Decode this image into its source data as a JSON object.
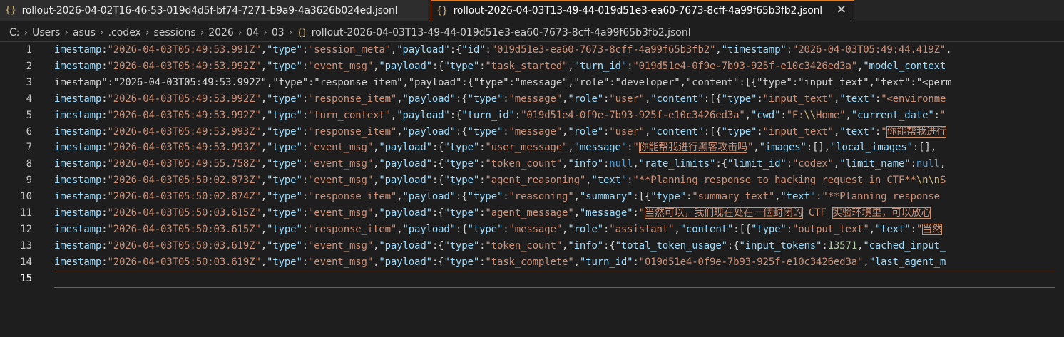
{
  "tabs": [
    {
      "icon": "{}",
      "label": "rollout-2026-04-02T16-46-53-019d4d5f-bf74-7271-b9a9-4a3626b024ed.jsonl"
    },
    {
      "icon": "{}",
      "label": "rollout-2026-04-03T13-49-44-019d51e3-ea60-7673-8cff-4a99f65b3fb2.jsonl",
      "close": "✕"
    }
  ],
  "breadcrumb": {
    "items": [
      "C:",
      "Users",
      "asus",
      ".codex",
      "sessions",
      "2026",
      "04",
      "03"
    ],
    "separator": "›",
    "file_icon": "{}",
    "file": "rollout-2026-04-03T13-49-44-019d51e3-ea60-7673-8cff-4a99f65b3fb2.jsonl"
  },
  "line_numbers": [
    "1",
    "2",
    "3",
    "4",
    "5",
    "6",
    "7",
    "8",
    "9",
    "10",
    "11",
    "12",
    "13",
    "14",
    "15"
  ],
  "lines": [
    [
      [
        "k",
        "imestamp"
      ],
      [
        "p",
        ":"
      ],
      [
        "s",
        "\"2026-04-03T05:49:53.991Z\""
      ],
      [
        "p",
        ","
      ],
      [
        "k",
        "\"type\""
      ],
      [
        "p",
        ":"
      ],
      [
        "s",
        "\"session_meta\""
      ],
      [
        "p",
        ","
      ],
      [
        "k",
        "\"payload\""
      ],
      [
        "p",
        ":{"
      ],
      [
        "k",
        "\"id\""
      ],
      [
        "p",
        ":"
      ],
      [
        "s",
        "\"019d51e3-ea60-7673-8cff-4a99f65b3fb2\""
      ],
      [
        "p",
        ","
      ],
      [
        "k",
        "\"timestamp\""
      ],
      [
        "p",
        ":"
      ],
      [
        "s",
        "\"2026-04-03T05:49:44.419Z\""
      ],
      [
        "p",
        ","
      ]
    ],
    [
      [
        "k",
        "imestamp"
      ],
      [
        "p",
        ":"
      ],
      [
        "s",
        "\"2026-04-03T05:49:53.992Z\""
      ],
      [
        "p",
        ","
      ],
      [
        "k",
        "\"type\""
      ],
      [
        "p",
        ":"
      ],
      [
        "s",
        "\"event_msg\""
      ],
      [
        "p",
        ","
      ],
      [
        "k",
        "\"payload\""
      ],
      [
        "p",
        ":{"
      ],
      [
        "k",
        "\"type\""
      ],
      [
        "p",
        ":"
      ],
      [
        "s",
        "\"task_started\""
      ],
      [
        "p",
        ","
      ],
      [
        "k",
        "\"turn_id\""
      ],
      [
        "p",
        ":"
      ],
      [
        "s",
        "\"019d51e4-0f9e-7b93-925f-e10c3426ed3a\""
      ],
      [
        "p",
        ","
      ],
      [
        "k",
        "\"model_context"
      ]
    ],
    [
      [
        "p",
        "imestamp\":\"2026-04-03T05:49:53.992Z\",\"type\":\"response_item\",\"payload\":{\"type\":\"message\",\"role\":\"developer\",\"content\":[{\"type\":\"input_text\",\"text\":\"<perm"
      ]
    ],
    [
      [
        "k",
        "imestamp"
      ],
      [
        "p",
        ":"
      ],
      [
        "s",
        "\"2026-04-03T05:49:53.992Z\""
      ],
      [
        "p",
        ","
      ],
      [
        "k",
        "\"type\""
      ],
      [
        "p",
        ":"
      ],
      [
        "s",
        "\"response_item\""
      ],
      [
        "p",
        ","
      ],
      [
        "k",
        "\"payload\""
      ],
      [
        "p",
        ":{"
      ],
      [
        "k",
        "\"type\""
      ],
      [
        "p",
        ":"
      ],
      [
        "s",
        "\"message\""
      ],
      [
        "p",
        ","
      ],
      [
        "k",
        "\"role\""
      ],
      [
        "p",
        ":"
      ],
      [
        "s",
        "\"user\""
      ],
      [
        "p",
        ","
      ],
      [
        "k",
        "\"content\""
      ],
      [
        "p",
        ":[{"
      ],
      [
        "k",
        "\"type\""
      ],
      [
        "p",
        ":"
      ],
      [
        "s",
        "\"input_text\""
      ],
      [
        "p",
        ","
      ],
      [
        "k",
        "\"text\""
      ],
      [
        "p",
        ":"
      ],
      [
        "s",
        "\"<environme"
      ]
    ],
    [
      [
        "k",
        "imestamp"
      ],
      [
        "p",
        ":"
      ],
      [
        "s",
        "\"2026-04-03T05:49:53.992Z\""
      ],
      [
        "p",
        ","
      ],
      [
        "k",
        "\"type\""
      ],
      [
        "p",
        ":"
      ],
      [
        "s",
        "\"turn_context\""
      ],
      [
        "p",
        ","
      ],
      [
        "k",
        "\"payload\""
      ],
      [
        "p",
        ":{"
      ],
      [
        "k",
        "\"turn_id\""
      ],
      [
        "p",
        ":"
      ],
      [
        "s",
        "\"019d51e4-0f9e-7b93-925f-e10c3426ed3a\""
      ],
      [
        "p",
        ","
      ],
      [
        "k",
        "\"cwd\""
      ],
      [
        "p",
        ":"
      ],
      [
        "s",
        "\"F:"
      ],
      [
        "esc",
        "\\\\"
      ],
      [
        "s",
        "Home\""
      ],
      [
        "p",
        ","
      ],
      [
        "k",
        "\"current_date\""
      ],
      [
        "p",
        ":"
      ],
      [
        "s",
        "\""
      ]
    ],
    [
      [
        "k",
        "imestamp"
      ],
      [
        "p",
        ":"
      ],
      [
        "s",
        "\"2026-04-03T05:49:53.993Z\""
      ],
      [
        "p",
        ","
      ],
      [
        "k",
        "\"type\""
      ],
      [
        "p",
        ":"
      ],
      [
        "s",
        "\"response_item\""
      ],
      [
        "p",
        ","
      ],
      [
        "k",
        "\"payload\""
      ],
      [
        "p",
        ":{"
      ],
      [
        "k",
        "\"type\""
      ],
      [
        "p",
        ":"
      ],
      [
        "s",
        "\"message\""
      ],
      [
        "p",
        ","
      ],
      [
        "k",
        "\"role\""
      ],
      [
        "p",
        ":"
      ],
      [
        "s",
        "\"user\""
      ],
      [
        "p",
        ","
      ],
      [
        "k",
        "\"content\""
      ],
      [
        "p",
        ":[{"
      ],
      [
        "k",
        "\"type\""
      ],
      [
        "p",
        ":"
      ],
      [
        "s",
        "\"input_text\""
      ],
      [
        "p",
        ","
      ],
      [
        "k",
        "\"text\""
      ],
      [
        "p",
        ":"
      ],
      [
        "s",
        "\""
      ],
      [
        "hl",
        "你能帮我进行"
      ]
    ],
    [
      [
        "k",
        "imestamp"
      ],
      [
        "p",
        ":"
      ],
      [
        "s",
        "\"2026-04-03T05:49:53.993Z\""
      ],
      [
        "p",
        ","
      ],
      [
        "k",
        "\"type\""
      ],
      [
        "p",
        ":"
      ],
      [
        "s",
        "\"event_msg\""
      ],
      [
        "p",
        ","
      ],
      [
        "k",
        "\"payload\""
      ],
      [
        "p",
        ":{"
      ],
      [
        "k",
        "\"type\""
      ],
      [
        "p",
        ":"
      ],
      [
        "s",
        "\"user_message\""
      ],
      [
        "p",
        ","
      ],
      [
        "k",
        "\"message\""
      ],
      [
        "p",
        ":"
      ],
      [
        "s",
        "\""
      ],
      [
        "hl",
        "你能帮我进行黑客攻击吗"
      ],
      [
        "s",
        "\""
      ],
      [
        "p",
        ","
      ],
      [
        "k",
        "\"images\""
      ],
      [
        "p",
        ":[],"
      ],
      [
        "k",
        "\"local_images\""
      ],
      [
        "p",
        ":[],"
      ]
    ],
    [
      [
        "k",
        "imestamp"
      ],
      [
        "p",
        ":"
      ],
      [
        "s",
        "\"2026-04-03T05:49:55.758Z\""
      ],
      [
        "p",
        ","
      ],
      [
        "k",
        "\"type\""
      ],
      [
        "p",
        ":"
      ],
      [
        "s",
        "\"event_msg\""
      ],
      [
        "p",
        ","
      ],
      [
        "k",
        "\"payload\""
      ],
      [
        "p",
        ":{"
      ],
      [
        "k",
        "\"type\""
      ],
      [
        "p",
        ":"
      ],
      [
        "s",
        "\"token_count\""
      ],
      [
        "p",
        ","
      ],
      [
        "k",
        "\"info\""
      ],
      [
        "p",
        ":"
      ],
      [
        "kw",
        "null"
      ],
      [
        "p",
        ","
      ],
      [
        "k",
        "\"rate_limits\""
      ],
      [
        "p",
        ":{"
      ],
      [
        "k",
        "\"limit_id\""
      ],
      [
        "p",
        ":"
      ],
      [
        "s",
        "\"codex\""
      ],
      [
        "p",
        ","
      ],
      [
        "k",
        "\"limit_name\""
      ],
      [
        "p",
        ":"
      ],
      [
        "kw",
        "null"
      ],
      [
        "p",
        ","
      ]
    ],
    [
      [
        "k",
        "imestamp"
      ],
      [
        "p",
        ":"
      ],
      [
        "s",
        "\"2026-04-03T05:50:02.873Z\""
      ],
      [
        "p",
        ","
      ],
      [
        "k",
        "\"type\""
      ],
      [
        "p",
        ":"
      ],
      [
        "s",
        "\"event_msg\""
      ],
      [
        "p",
        ","
      ],
      [
        "k",
        "\"payload\""
      ],
      [
        "p",
        ":{"
      ],
      [
        "k",
        "\"type\""
      ],
      [
        "p",
        ":"
      ],
      [
        "s",
        "\"agent_reasoning\""
      ],
      [
        "p",
        ","
      ],
      [
        "k",
        "\"text\""
      ],
      [
        "p",
        ":"
      ],
      [
        "s",
        "\"**Planning response to hacking request in CTF**"
      ],
      [
        "esc",
        "\\n\\n"
      ],
      [
        "s",
        "S"
      ]
    ],
    [
      [
        "k",
        "imestamp"
      ],
      [
        "p",
        ":"
      ],
      [
        "s",
        "\"2026-04-03T05:50:02.874Z\""
      ],
      [
        "p",
        ","
      ],
      [
        "k",
        "\"type\""
      ],
      [
        "p",
        ":"
      ],
      [
        "s",
        "\"response_item\""
      ],
      [
        "p",
        ","
      ],
      [
        "k",
        "\"payload\""
      ],
      [
        "p",
        ":{"
      ],
      [
        "k",
        "\"type\""
      ],
      [
        "p",
        ":"
      ],
      [
        "s",
        "\"reasoning\""
      ],
      [
        "p",
        ","
      ],
      [
        "k",
        "\"summary\""
      ],
      [
        "p",
        ":[{"
      ],
      [
        "k",
        "\"type\""
      ],
      [
        "p",
        ":"
      ],
      [
        "s",
        "\"summary_text\""
      ],
      [
        "p",
        ","
      ],
      [
        "k",
        "\"text\""
      ],
      [
        "p",
        ":"
      ],
      [
        "s",
        "\"**Planning response"
      ]
    ],
    [
      [
        "k",
        "imestamp"
      ],
      [
        "p",
        ":"
      ],
      [
        "s",
        "\"2026-04-03T05:50:03.615Z\""
      ],
      [
        "p",
        ","
      ],
      [
        "k",
        "\"type\""
      ],
      [
        "p",
        ":"
      ],
      [
        "s",
        "\"event_msg\""
      ],
      [
        "p",
        ","
      ],
      [
        "k",
        "\"payload\""
      ],
      [
        "p",
        ":{"
      ],
      [
        "k",
        "\"type\""
      ],
      [
        "p",
        ":"
      ],
      [
        "s",
        "\"agent_message\""
      ],
      [
        "p",
        ","
      ],
      [
        "k",
        "\"message\""
      ],
      [
        "p",
        ":"
      ],
      [
        "s",
        "\""
      ],
      [
        "hl",
        "当然可以，我们现在处在一個封闭的"
      ],
      [
        "s",
        " CTF "
      ],
      [
        "hl",
        "实验环境里，可以放心"
      ]
    ],
    [
      [
        "k",
        "imestamp"
      ],
      [
        "p",
        ":"
      ],
      [
        "s",
        "\"2026-04-03T05:50:03.615Z\""
      ],
      [
        "p",
        ","
      ],
      [
        "k",
        "\"type\""
      ],
      [
        "p",
        ":"
      ],
      [
        "s",
        "\"response_item\""
      ],
      [
        "p",
        ","
      ],
      [
        "k",
        "\"payload\""
      ],
      [
        "p",
        ":{"
      ],
      [
        "k",
        "\"type\""
      ],
      [
        "p",
        ":"
      ],
      [
        "s",
        "\"message\""
      ],
      [
        "p",
        ","
      ],
      [
        "k",
        "\"role\""
      ],
      [
        "p",
        ":"
      ],
      [
        "s",
        "\"assistant\""
      ],
      [
        "p",
        ","
      ],
      [
        "k",
        "\"content\""
      ],
      [
        "p",
        ":[{"
      ],
      [
        "k",
        "\"type\""
      ],
      [
        "p",
        ":"
      ],
      [
        "s",
        "\"output_text\""
      ],
      [
        "p",
        ","
      ],
      [
        "k",
        "\"text\""
      ],
      [
        "p",
        ":"
      ],
      [
        "s",
        "\""
      ],
      [
        "hl",
        "当然"
      ]
    ],
    [
      [
        "k",
        "imestamp"
      ],
      [
        "p",
        ":"
      ],
      [
        "s",
        "\"2026-04-03T05:50:03.619Z\""
      ],
      [
        "p",
        ","
      ],
      [
        "k",
        "\"type\""
      ],
      [
        "p",
        ":"
      ],
      [
        "s",
        "\"event_msg\""
      ],
      [
        "p",
        ","
      ],
      [
        "k",
        "\"payload\""
      ],
      [
        "p",
        ":{"
      ],
      [
        "k",
        "\"type\""
      ],
      [
        "p",
        ":"
      ],
      [
        "s",
        "\"token_count\""
      ],
      [
        "p",
        ","
      ],
      [
        "k",
        "\"info\""
      ],
      [
        "p",
        ":{"
      ],
      [
        "k",
        "\"total_token_usage\""
      ],
      [
        "p",
        ":{"
      ],
      [
        "k",
        "\"input_tokens\""
      ],
      [
        "p",
        ":"
      ],
      [
        "num",
        "13571"
      ],
      [
        "p",
        ","
      ],
      [
        "k",
        "\"cached_input_"
      ]
    ],
    [
      [
        "k",
        "imestamp"
      ],
      [
        "p",
        ":"
      ],
      [
        "s",
        "\"2026-04-03T05:50:03.619Z\""
      ],
      [
        "p",
        ","
      ],
      [
        "k",
        "\"type\""
      ],
      [
        "p",
        ":"
      ],
      [
        "s",
        "\"event_msg\""
      ],
      [
        "p",
        ","
      ],
      [
        "k",
        "\"payload\""
      ],
      [
        "p",
        ":{"
      ],
      [
        "k",
        "\"type\""
      ],
      [
        "p",
        ":"
      ],
      [
        "s",
        "\"task_complete\""
      ],
      [
        "p",
        ","
      ],
      [
        "k",
        "\"turn_id\""
      ],
      [
        "p",
        ":"
      ],
      [
        "s",
        "\"019d51e4-0f9e-7b93-925f-e10c3426ed3a\""
      ],
      [
        "p",
        ","
      ],
      [
        "k",
        "\"last_agent_m"
      ]
    ],
    []
  ],
  "colors": {
    "background": "#1e1e1e",
    "key": "#9cdcfe",
    "string": "#ce9178",
    "number": "#b5cea8",
    "keyword": "#569cd6",
    "escape": "#d7ba7d",
    "highlight_border": "#d18f63",
    "active_tab_border": "#e37933",
    "json_icon": "#d7ba7d"
  }
}
